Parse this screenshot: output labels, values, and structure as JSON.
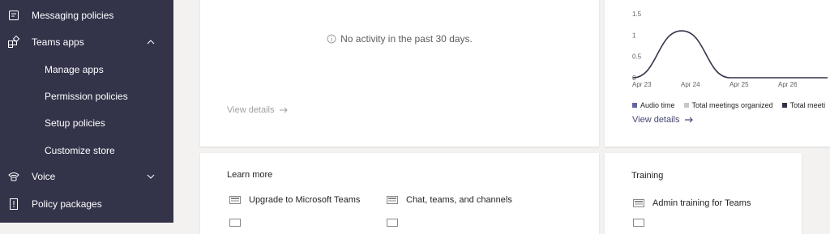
{
  "sidebar": {
    "items": [
      {
        "label": "Messaging policies",
        "icon": "messaging-icon"
      },
      {
        "label": "Teams apps",
        "icon": "apps-icon",
        "expanded": true
      },
      {
        "label": "Manage apps"
      },
      {
        "label": "Permission policies"
      },
      {
        "label": "Setup policies"
      },
      {
        "label": "Customize store"
      },
      {
        "label": "Voice",
        "icon": "voice-icon",
        "expanded": false
      },
      {
        "label": "Policy packages",
        "icon": "policy-packages-icon"
      }
    ]
  },
  "activity_card": {
    "message": "No activity in the past 30 days.",
    "view_details": "View details"
  },
  "meetings_card": {
    "legend": [
      "Audio time",
      "Total meetings organized",
      "Total meeti"
    ],
    "view_details": "View details"
  },
  "learn_more": {
    "title": "Learn more",
    "links": [
      "Upgrade to Microsoft Teams",
      "Chat, teams, and channels"
    ]
  },
  "training": {
    "title": "Training",
    "links": [
      "Admin training for Teams"
    ]
  },
  "colors": {
    "sidebar_bg": "#33344a",
    "accent": "#464775",
    "legend_audio": "#6264a7",
    "legend_meetings": "#c8c6c4",
    "legend_total": "#33344a"
  },
  "chart_data": {
    "type": "line",
    "x": [
      "Apr 23",
      "Apr 24",
      "Apr 25",
      "Apr 26"
    ],
    "y_ticks": [
      "0",
      "0.5",
      "1",
      "1.5"
    ],
    "ylim": [
      0,
      1.5
    ],
    "series": [
      {
        "values": [
          0,
          1.1,
          0,
          0,
          0
        ]
      }
    ],
    "x_points": [
      0,
      1,
      2,
      3,
      4
    ],
    "legend_position": "bottom"
  }
}
